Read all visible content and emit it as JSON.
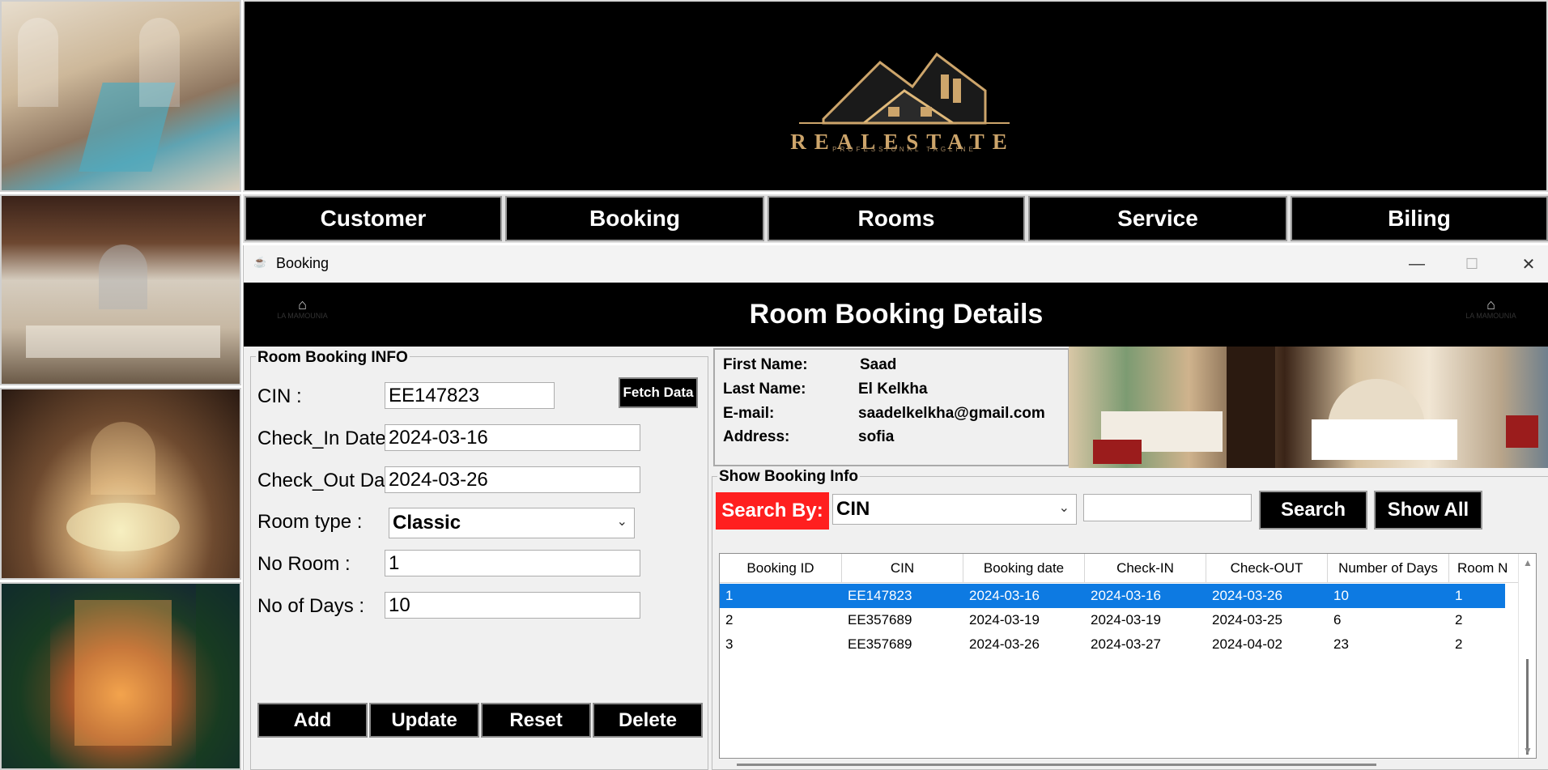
{
  "banner": {
    "logo_text": "REALESTATE",
    "logo_tagline": "PROFESSIONAL TAGLINE"
  },
  "nav": [
    {
      "label": "Customer"
    },
    {
      "label": "Booking"
    },
    {
      "label": "Rooms"
    },
    {
      "label": "Service"
    },
    {
      "label": "Biling"
    }
  ],
  "window": {
    "title": "Booking",
    "controls": {
      "minimize": "—",
      "maximize": "☐",
      "close": "✕"
    },
    "header_title": "Room Booking Details",
    "mini_logo_text": "LA MAMOUNIA"
  },
  "form": {
    "legend": "Room Booking INFO",
    "cin_label": "CIN :",
    "cin_value": "EE147823",
    "fetch_label": "Fetch Data",
    "checkin_label": "Check_In Date :",
    "checkin_value": "2024-03-16",
    "checkout_label": "Check_Out Date :",
    "checkout_value": "2024-03-26",
    "roomtype_label": "Room type :",
    "roomtype_value": "Classic",
    "noroom_label": "No Room :",
    "noroom_value": "1",
    "nodays_label": "No of Days :",
    "nodays_value": "10",
    "buttons": {
      "add": "Add",
      "update": "Update",
      "reset": "Reset",
      "delete": "Delete"
    }
  },
  "customer": {
    "first_name_label": "First Name:",
    "first_name": "Saad",
    "last_name_label": "Last Name:",
    "last_name": "El Kelkha",
    "email_label": "E-mail:",
    "email": "saadelkelkha@gmail.com",
    "address_label": "Address:",
    "address": "sofia"
  },
  "show": {
    "legend": "Show Booking Info",
    "search_by_label": "Search By:",
    "search_by_value": "CIN",
    "search_text": "",
    "search_button": "Search",
    "show_all_button": "Show All"
  },
  "table": {
    "columns": [
      "Booking ID",
      "CIN",
      "Booking date",
      "Check-IN",
      "Check-OUT",
      "Number of Days",
      "Room N"
    ],
    "rows": [
      [
        "1",
        "EE147823",
        "2024-03-16",
        "2024-03-16",
        "2024-03-26",
        "10",
        "1"
      ],
      [
        "2",
        "EE357689",
        "2024-03-19",
        "2024-03-19",
        "2024-03-25",
        "6",
        "2"
      ],
      [
        "3",
        "EE357689",
        "2024-03-26",
        "2024-03-27",
        "2024-04-02",
        "23",
        "2"
      ]
    ],
    "selected_row": 0
  },
  "colors": {
    "accent_red": "#ff1f1f",
    "selection_blue": "#0d7ae2",
    "logo_gold": "#cda56b"
  }
}
